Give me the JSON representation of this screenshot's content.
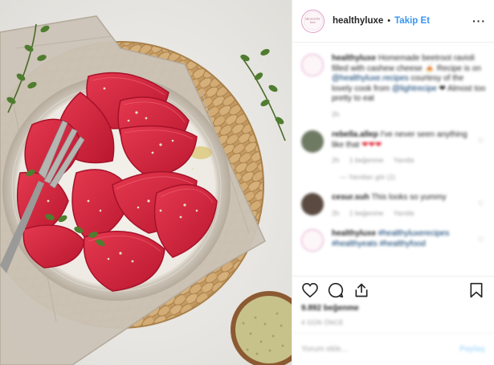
{
  "post": {
    "colors": {
      "accent": "#3897f0",
      "plate_rim": "#d6d0c5",
      "ravioli": "#d8283f",
      "mat": "#c8a26f",
      "cloth": "#c9c1b5"
    }
  },
  "header": {
    "avatar_text": "HEALTHY luxe",
    "username": "healthyluxe",
    "separator": "•",
    "follow_label": "Takip Et",
    "more_icon": "more-dots-icon",
    "more_label": "···"
  },
  "comments": [
    {
      "username": "healthyluxe",
      "text": "Homemade beetroot ravioli filled with cashew cheese 🍝 Recipe is on",
      "tag1": "@healthyluxe.recipes",
      "text2": "courtesy of the lovely cook from",
      "tag2": "@lightrecipe",
      "text3": "❤ Almost too pretty to eat",
      "time": "2h"
    },
    {
      "username": "rebella.allep",
      "text": "I've never seen anything like that",
      "emoji": "❤❤❤",
      "time": "2h",
      "likes": "1 beğenme",
      "reply": "Yanıtla",
      "sub": "— Yanıtları gör (1)"
    },
    {
      "username": "cesur.suh",
      "text": "This looks so yummy",
      "time": "2h",
      "likes": "1 beğenme",
      "reply": "Yanıtla"
    },
    {
      "username": "healthyluxe",
      "tags": "#healthyluxerecipes #healthyeats #healthyfood",
      "time": ""
    }
  ],
  "actions": {
    "icons": [
      "heart-icon",
      "comment-icon",
      "share-icon",
      "bookmark-icon"
    ],
    "likes": "9.892 beğenme",
    "time": "4 GÜN ÖNCE"
  },
  "add_comment": {
    "placeholder": "Yorum ekle...",
    "share_label": "Paylaş"
  }
}
